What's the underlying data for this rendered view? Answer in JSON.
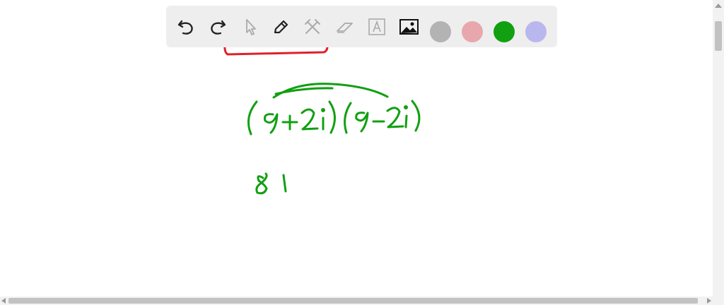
{
  "toolbar": {
    "tools": [
      {
        "icon": "undo-icon",
        "enabled": true
      },
      {
        "icon": "redo-icon",
        "enabled": true
      },
      {
        "icon": "pointer-icon",
        "enabled": false
      },
      {
        "icon": "pen-icon",
        "enabled": true
      },
      {
        "icon": "tools-icon",
        "enabled": false
      },
      {
        "icon": "eraser-icon",
        "enabled": false
      },
      {
        "icon": "text-icon",
        "enabled": false
      },
      {
        "icon": "image-icon",
        "enabled": true
      }
    ],
    "colors": [
      "#b3b3b3",
      "#e8a7ad",
      "#11a011",
      "#b9b7ee"
    ],
    "selected_color": "#11a011",
    "annotation_color": "#e0202a"
  },
  "whiteboard": {
    "ink_color": "#11a011",
    "expression": "(9+2i)(9-2i)",
    "step_1": "81"
  }
}
